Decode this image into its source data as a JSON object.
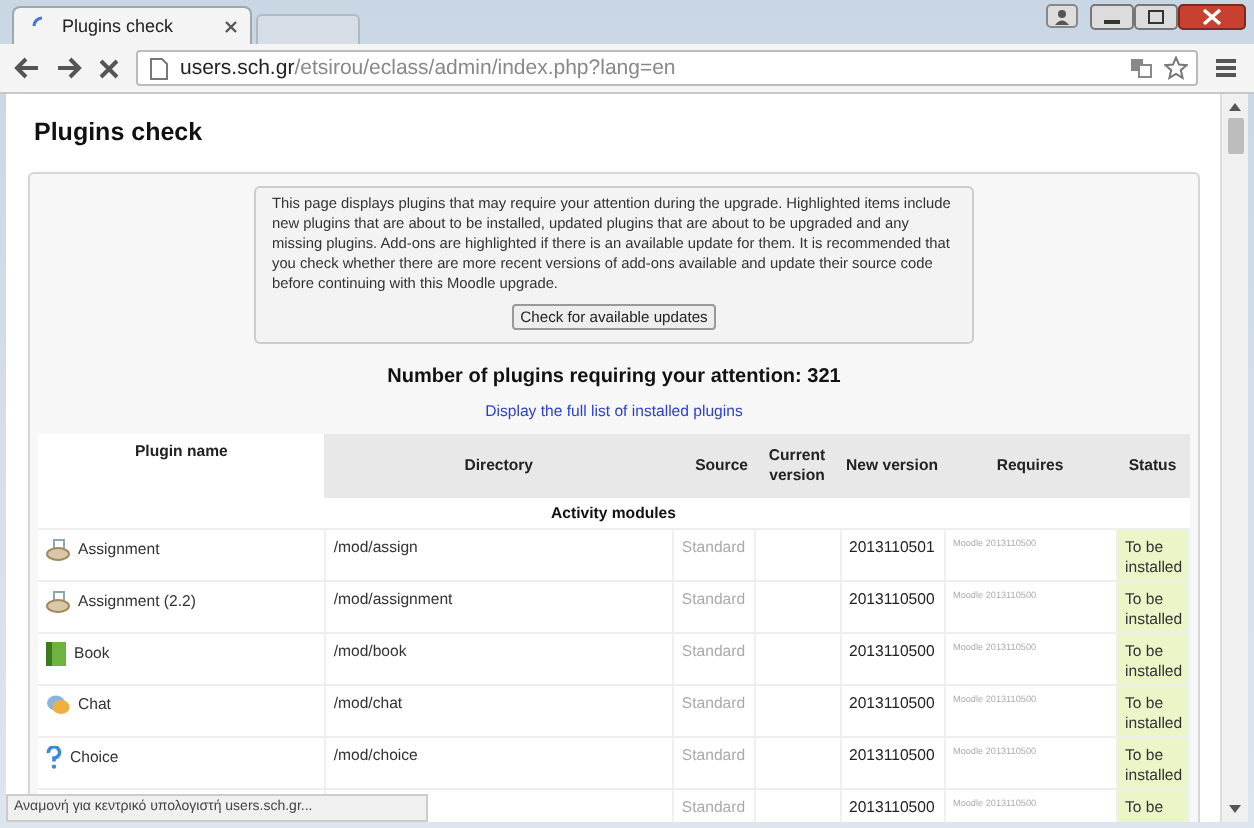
{
  "browser": {
    "tab": {
      "title": "Plugins check"
    },
    "url": {
      "host": "users.sch.gr",
      "path": "/etsirou/eclass/admin/index.php?lang=en"
    }
  },
  "page": {
    "title": "Plugins check",
    "notice": "This page displays plugins that may require your attention during the upgrade. Highlighted items include new plugins that are about to be installed, updated plugins that are about to be upgraded and any missing plugins. Add-ons are highlighted if there is an available update for them. It is recommended that you check whether there are more recent versions of add-ons available and update their source code before continuing with this Moodle upgrade.",
    "check_button": "Check for available updates",
    "count_heading": "Number of plugins requiring your attention: 321",
    "full_list_link": "Display the full list of installed plugins"
  },
  "table": {
    "columns": [
      "Plugin name",
      "Directory",
      "Source",
      "Current version",
      "New version",
      "Requires",
      "Status"
    ],
    "groups": [
      {
        "title": "Activity modules",
        "rows": [
          {
            "kind": "assignment",
            "name": "Assignment",
            "directory": "/mod/assign",
            "source": "Standard",
            "new_version": "2013110501",
            "requires": "Moodle 2013110500",
            "status": "To be installed"
          },
          {
            "kind": "assignment",
            "name": "Assignment (2.2)",
            "directory": "/mod/assignment",
            "source": "Standard",
            "new_version": "2013110500",
            "requires": "Moodle 2013110500",
            "status": "To be installed"
          },
          {
            "kind": "book",
            "name": "Book",
            "directory": "/mod/book",
            "source": "Standard",
            "new_version": "2013110500",
            "requires": "Moodle 2013110500",
            "status": "To be installed"
          },
          {
            "kind": "chat",
            "name": "Chat",
            "directory": "/mod/chat",
            "source": "Standard",
            "new_version": "2013110500",
            "requires": "Moodle 2013110500",
            "status": "To be installed"
          },
          {
            "kind": "choice",
            "name": "Choice",
            "directory": "/mod/choice",
            "source": "Standard",
            "new_version": "2013110500",
            "requires": "Moodle 2013110500",
            "status": "To be installed"
          },
          {
            "source": "Standard",
            "new_version": "2013110500",
            "requires": "Moodle 2013110500",
            "status": "To be"
          }
        ]
      }
    ]
  },
  "status_bar": "Αναμονή για κεντρικό υπολογιστή users.sch.gr..."
}
